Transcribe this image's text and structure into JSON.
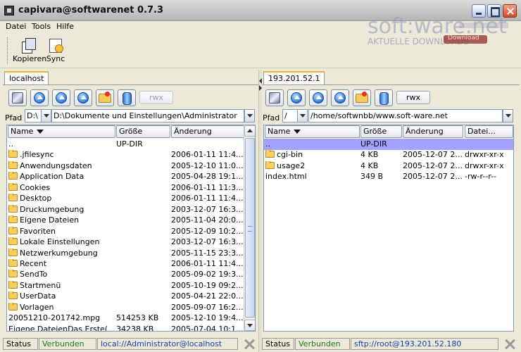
{
  "window": {
    "title": "capivara@softwarenet 0.7.3"
  },
  "watermark": {
    "big": "soft:ware.net",
    "small": "AKTUELLE DOWNLOADS",
    "badge": "Download"
  },
  "menu": [
    "Datei",
    "Tools",
    "Hilfe"
  ],
  "toolbar": {
    "copy_label": "Kopieren",
    "sync_label": "Sync"
  },
  "left": {
    "tab": "localhost",
    "rwx": "rwx",
    "path_label": "Pfad",
    "drive": "D:\\",
    "path": "D:\\Dokumente und Einstellungen\\Administrator",
    "headers": {
      "name": "Name",
      "size": "Größe",
      "changed": "Änderung"
    },
    "rows": [
      {
        "name": "..",
        "size": "UP-DIR",
        "date": "",
        "folder": false
      },
      {
        "name": ".jfilesync",
        "size": "",
        "date": "2006-01-11 11:4...",
        "folder": true
      },
      {
        "name": "Anwendungsdaten",
        "size": "",
        "date": "2005-12-10 11:0...",
        "folder": true
      },
      {
        "name": "Application Data",
        "size": "",
        "date": "2005-04-28 19:1...",
        "folder": true
      },
      {
        "name": "Cookies",
        "size": "",
        "date": "2006-01-11 11:3...",
        "folder": true
      },
      {
        "name": "Desktop",
        "size": "",
        "date": "2006-01-11 11:4...",
        "folder": true
      },
      {
        "name": "Druckumgebung",
        "size": "",
        "date": "2003-12-07 16:3...",
        "folder": true
      },
      {
        "name": "Eigene Dateien",
        "size": "",
        "date": "2005-11-04 20:0...",
        "folder": true
      },
      {
        "name": "Favoriten",
        "size": "",
        "date": "2005-12-09 10:2...",
        "folder": true
      },
      {
        "name": "Lokale Einstellungen",
        "size": "",
        "date": "2003-12-07 16:3...",
        "folder": true
      },
      {
        "name": "Netzwerkumgebung",
        "size": "",
        "date": "2005-11-15 23:3...",
        "folder": true
      },
      {
        "name": "Recent",
        "size": "",
        "date": "2006-01-11 11:4...",
        "folder": true
      },
      {
        "name": "SendTo",
        "size": "",
        "date": "2005-09-02 19:3...",
        "folder": true
      },
      {
        "name": "Startmenü",
        "size": "",
        "date": "2005-10-19 09:2...",
        "folder": true
      },
      {
        "name": "UserData",
        "size": "",
        "date": "2005-04-21 22:0...",
        "folder": true
      },
      {
        "name": "Vorlagen",
        "size": "",
        "date": "2005-09-07 16:2...",
        "folder": true
      },
      {
        "name": "20051210-201742.mpg",
        "size": "514253 KB",
        "date": "2005-12-10 19:4...",
        "folder": false
      },
      {
        "name": "Eigene DateienDas Erste(...",
        "size": "34238 KB",
        "date": "2005-07-04 10:1...",
        "folder": false
      }
    ],
    "status": {
      "label": "Status",
      "state": "Verbunden",
      "conn": "local://Administrator@localhost"
    }
  },
  "right": {
    "tab": "193.201.52.1",
    "rwx": "rwx",
    "path_label": "Pfad",
    "drive": "/",
    "path": "/home/softwnbb/www.soft-ware.net",
    "headers": {
      "name": "Name",
      "size": "Größe",
      "changed": "Änderung",
      "perm": "Datei..."
    },
    "rows": [
      {
        "name": "..",
        "size": "UP-DIR",
        "date": "",
        "perm": "",
        "folder": false,
        "selected": true
      },
      {
        "name": "cgi-bin",
        "size": "4 KB",
        "date": "2005-12-07 2...",
        "perm": "drwxr-xr-x",
        "folder": true
      },
      {
        "name": "usage2",
        "size": "4 KB",
        "date": "2005-12-07 2...",
        "perm": "drwxr-xr-x",
        "folder": true
      },
      {
        "name": "index.html",
        "size": "349 B",
        "date": "2005-12-07 2...",
        "perm": "-rw-r--r--",
        "folder": false
      }
    ],
    "status": {
      "label": "Status",
      "state": "Verbunden",
      "conn": "sftp://root@193.201.52.180"
    }
  }
}
